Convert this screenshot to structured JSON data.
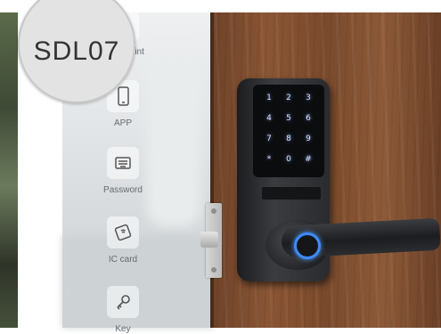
{
  "badge": {
    "model": "SDL07"
  },
  "features": [
    {
      "label": "Fingerprint",
      "icon": "fingerprint-icon"
    },
    {
      "label": "APP",
      "icon": "smartphone-icon"
    },
    {
      "label": "Password",
      "icon": "keypad-icon"
    },
    {
      "label": "IC card",
      "icon": "card-icon"
    },
    {
      "label": "Key",
      "icon": "key-icon"
    }
  ],
  "keypad": {
    "keys": [
      "1",
      "2",
      "3",
      "4",
      "5",
      "6",
      "7",
      "8",
      "9",
      "*",
      "0",
      "#"
    ]
  },
  "colors": {
    "badge_bg": "#e3e3e3",
    "keypad_glow": "#7fa0ff",
    "fingerprint_ring": "#3d8bff"
  }
}
